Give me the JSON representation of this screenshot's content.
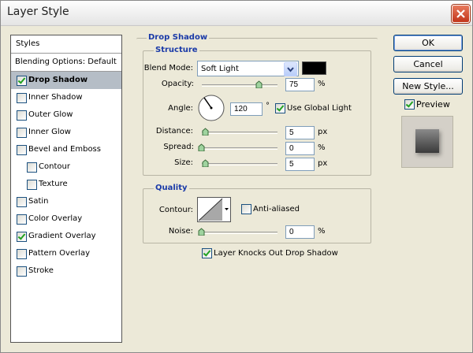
{
  "window": {
    "title": "Layer Style"
  },
  "sidebar": {
    "header": "Styles",
    "blending": "Blending Options: Default",
    "items": [
      {
        "label": "Drop Shadow",
        "checked": true,
        "selected": true,
        "indent": false
      },
      {
        "label": "Inner Shadow",
        "checked": false,
        "selected": false,
        "indent": false
      },
      {
        "label": "Outer Glow",
        "checked": false,
        "selected": false,
        "indent": false
      },
      {
        "label": "Inner Glow",
        "checked": false,
        "selected": false,
        "indent": false
      },
      {
        "label": "Bevel and Emboss",
        "checked": false,
        "selected": false,
        "indent": false
      },
      {
        "label": "Contour",
        "checked": false,
        "selected": false,
        "indent": true
      },
      {
        "label": "Texture",
        "checked": false,
        "selected": false,
        "indent": true
      },
      {
        "label": "Satin",
        "checked": false,
        "selected": false,
        "indent": false
      },
      {
        "label": "Color Overlay",
        "checked": false,
        "selected": false,
        "indent": false
      },
      {
        "label": "Gradient Overlay",
        "checked": true,
        "selected": false,
        "indent": false
      },
      {
        "label": "Pattern Overlay",
        "checked": false,
        "selected": false,
        "indent": false
      },
      {
        "label": "Stroke",
        "checked": false,
        "selected": false,
        "indent": false
      }
    ]
  },
  "drop_shadow": {
    "title": "Drop Shadow",
    "structure": {
      "title": "Structure",
      "blend_mode_label": "Blend Mode:",
      "blend_mode_value": "Soft Light",
      "shadow_color": "#000000",
      "opacity_label": "Opacity:",
      "opacity_value": "75",
      "opacity_unit": "%",
      "angle_label": "Angle:",
      "angle_value": "120",
      "angle_unit": "°",
      "use_global_light_label": "Use Global Light",
      "use_global_light_checked": true,
      "distance_label": "Distance:",
      "distance_value": "5",
      "distance_unit": "px",
      "spread_label": "Spread:",
      "spread_value": "0",
      "spread_unit": "%",
      "size_label": "Size:",
      "size_value": "5",
      "size_unit": "px"
    },
    "quality": {
      "title": "Quality",
      "contour_label": "Contour:",
      "anti_aliased_label": "Anti-aliased",
      "anti_aliased_checked": false,
      "noise_label": "Noise:",
      "noise_value": "0",
      "noise_unit": "%"
    },
    "knocks_out_label": "Layer Knocks Out Drop Shadow",
    "knocks_out_checked": true
  },
  "buttons": {
    "ok": "OK",
    "cancel": "Cancel",
    "new_style": "New Style...",
    "preview_label": "Preview",
    "preview_checked": true
  }
}
